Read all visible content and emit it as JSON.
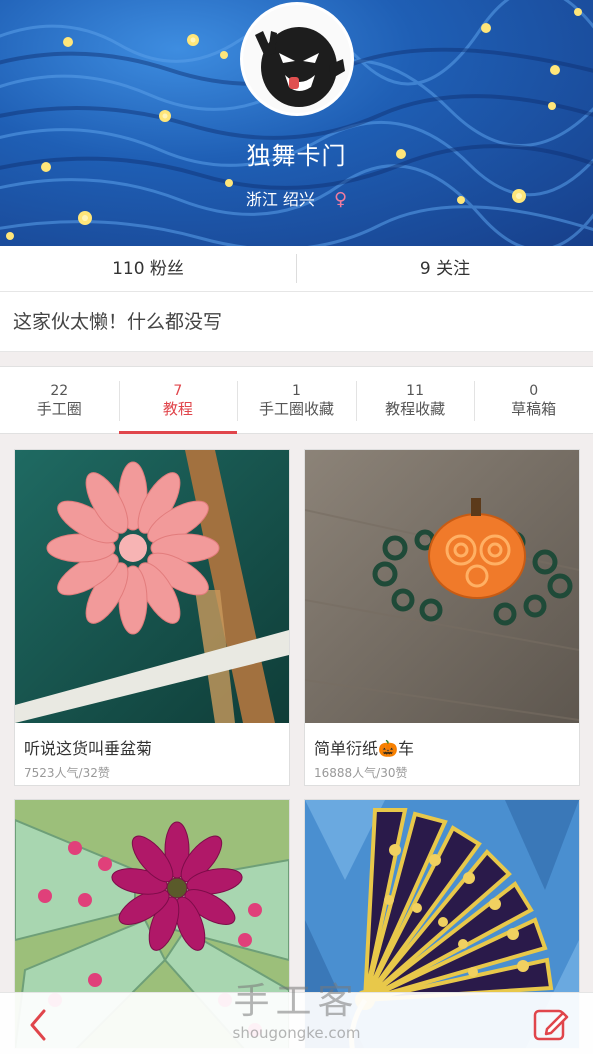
{
  "profile": {
    "nickname": "独舞卡门",
    "location": "浙江 绍兴",
    "gender_symbol": "♀",
    "bio": "这家伙太懒！什么都没写"
  },
  "stats": {
    "fans": "110 粉丝",
    "following": "9 关注"
  },
  "tabs": [
    {
      "count": "22",
      "label": "手工圈"
    },
    {
      "count": "7",
      "label": "教程"
    },
    {
      "count": "1",
      "label": "手工圈收藏"
    },
    {
      "count": "11",
      "label": "教程收藏"
    },
    {
      "count": "0",
      "label": "草稿箱"
    }
  ],
  "cards": [
    {
      "title": "听说这货叫垂盆菊",
      "meta": "7523人气/32赞"
    },
    {
      "title": "简单衍纸",
      "title_suffix": "车",
      "title_emoji": "🎃",
      "meta": "16888人气/30赞"
    },
    {
      "title": "",
      "meta": ""
    },
    {
      "title": "",
      "meta": ""
    }
  ],
  "watermark": {
    "cn": "手工客",
    "en": "shougongke.com"
  },
  "colors": {
    "accent": "#e0454b",
    "gender": "#f07ca0"
  }
}
